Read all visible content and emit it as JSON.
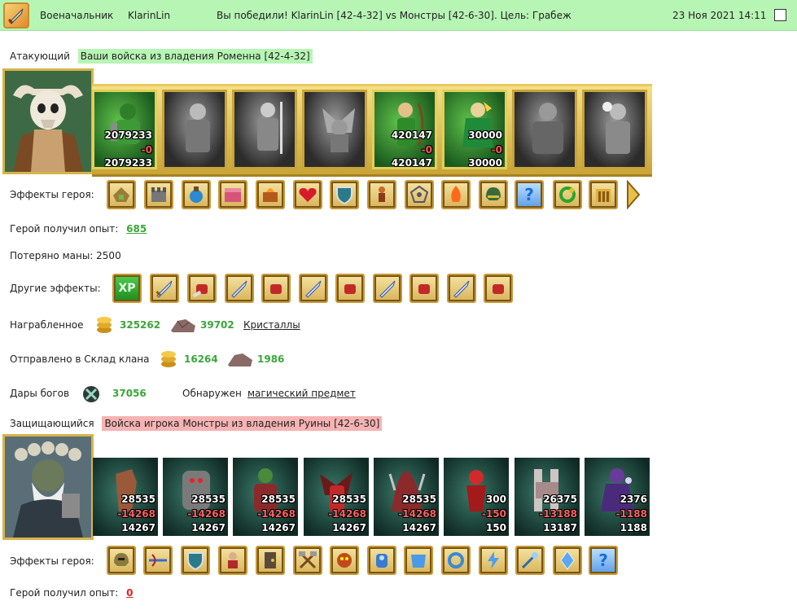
{
  "header": {
    "role": "Военачальник",
    "player": "KlarinLin",
    "result": "Вы победили! KlarinLin [42-4-32] vs Монстры [42-6-30]. Цель: Грабеж",
    "datetime": "23 Ноя 2021 14:11"
  },
  "attacker": {
    "label": "Атакующий",
    "origin": "Ваши войска из владения Роменна [42-4-32]",
    "units": [
      {
        "state": "alive",
        "total": "2079233",
        "lost": "-0",
        "left": "2079233"
      },
      {
        "state": "grey"
      },
      {
        "state": "grey"
      },
      {
        "state": "grey"
      },
      {
        "state": "alive",
        "total": "420147",
        "lost": "-0",
        "left": "420147"
      },
      {
        "state": "alive",
        "total": "30000",
        "lost": "-0",
        "left": "30000"
      },
      {
        "state": "grey"
      },
      {
        "state": "grey"
      }
    ],
    "effects_label": "Эффекты героя:",
    "effects": [
      "building-icon",
      "castle-icon",
      "potion-icon",
      "chest-icon",
      "fire-chest-icon",
      "heart-icon",
      "shield-icon",
      "warrior-icon",
      "web-icon",
      "fire-icon",
      "helmet-icon",
      "question-icon",
      "green-ring-icon",
      "gate-icon"
    ],
    "exp_label": "Герой получил опыт:",
    "exp_value": "685",
    "mana_label": "Потеряно маны: 2500",
    "other_label": "Другие эффекты:",
    "other_effects": [
      "xp-icon",
      "sword-icon",
      "fist-icon",
      "sword-icon",
      "fist-icon",
      "sword-icon",
      "fist-icon",
      "sword-icon",
      "fist-icon",
      "sword-icon",
      "fist-icon"
    ],
    "xp_text": "XP",
    "loot_label": "Награбленное",
    "loot_gold": "325262",
    "loot_ore": "39702",
    "loot_link": "Кристаллы",
    "clan_label": "Отправлено в Склад клана",
    "clan_gold": "16264",
    "clan_ore": "1986",
    "gifts_label": "Дары богов",
    "gifts_value": "37056",
    "found_label": "Обнаружен",
    "found_link": "магический предмет"
  },
  "defender": {
    "label": "Защищающийся",
    "origin": "Войска игрока Монстры из владения Руины [42-6-30]",
    "units": [
      {
        "total": "28535",
        "lost": "-14268",
        "left": "14267"
      },
      {
        "total": "28535",
        "lost": "-14268",
        "left": "14267"
      },
      {
        "total": "28535",
        "lost": "-14268",
        "left": "14267"
      },
      {
        "total": "28535",
        "lost": "-14268",
        "left": "14267"
      },
      {
        "total": "28535",
        "lost": "-14268",
        "left": "14267"
      },
      {
        "total": "300",
        "lost": "-150",
        "left": "150"
      },
      {
        "total": "26375",
        "lost": "-13188",
        "left": "13187"
      },
      {
        "total": "2376",
        "lost": "-1188",
        "left": "1188"
      }
    ],
    "effects_label": "Эффекты героя:",
    "effects": [
      "helmet-icon",
      "crossbow-icon",
      "shield-icon",
      "warrior-icon",
      "door-icon",
      "hammers-icon",
      "beast-head-icon",
      "ice-golem-icon",
      "ice-armor-icon",
      "ice-ring-icon",
      "ice-bolt-icon",
      "ice-staff-icon",
      "ice-crystal-icon",
      "question-icon"
    ],
    "exp_label": "Герой получил опыт:",
    "exp_value": "0"
  },
  "question_glyph": "?",
  "colors": {
    "header_bg": "#b7f5b4",
    "attacker_tag": "#b7f5b4",
    "defender_tag": "#f6b3b3",
    "positive": "#3aa63a",
    "negative": "#d22222"
  }
}
